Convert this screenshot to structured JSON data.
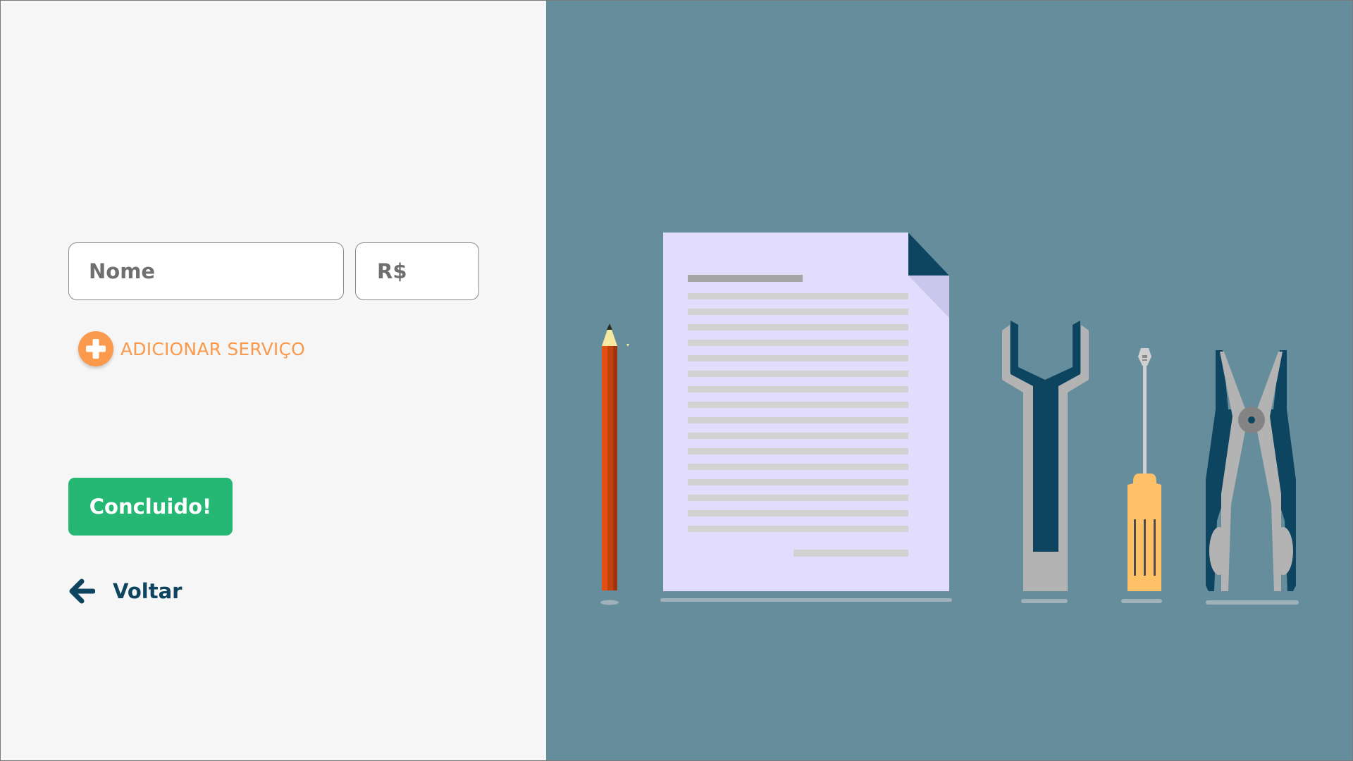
{
  "form": {
    "name_placeholder": "Nome",
    "price_placeholder": "R$",
    "add_service_label": "ADICIONAR SERVIÇO",
    "add_icon": "plus-circle-icon",
    "done_label": "Concluido!",
    "back_label": "Voltar",
    "back_icon": "arrow-left-icon"
  },
  "illustration": {
    "icons": [
      "pencil-icon",
      "document-icon",
      "wrench-icon",
      "screwdriver-icon",
      "pliers-icon"
    ]
  },
  "colors": {
    "left_background": "#f6f6f6",
    "right_background": "#668d9c",
    "accent_orange": "#fb9a4c",
    "button_green": "#25b874",
    "link_dark_blue": "#0d4560"
  }
}
